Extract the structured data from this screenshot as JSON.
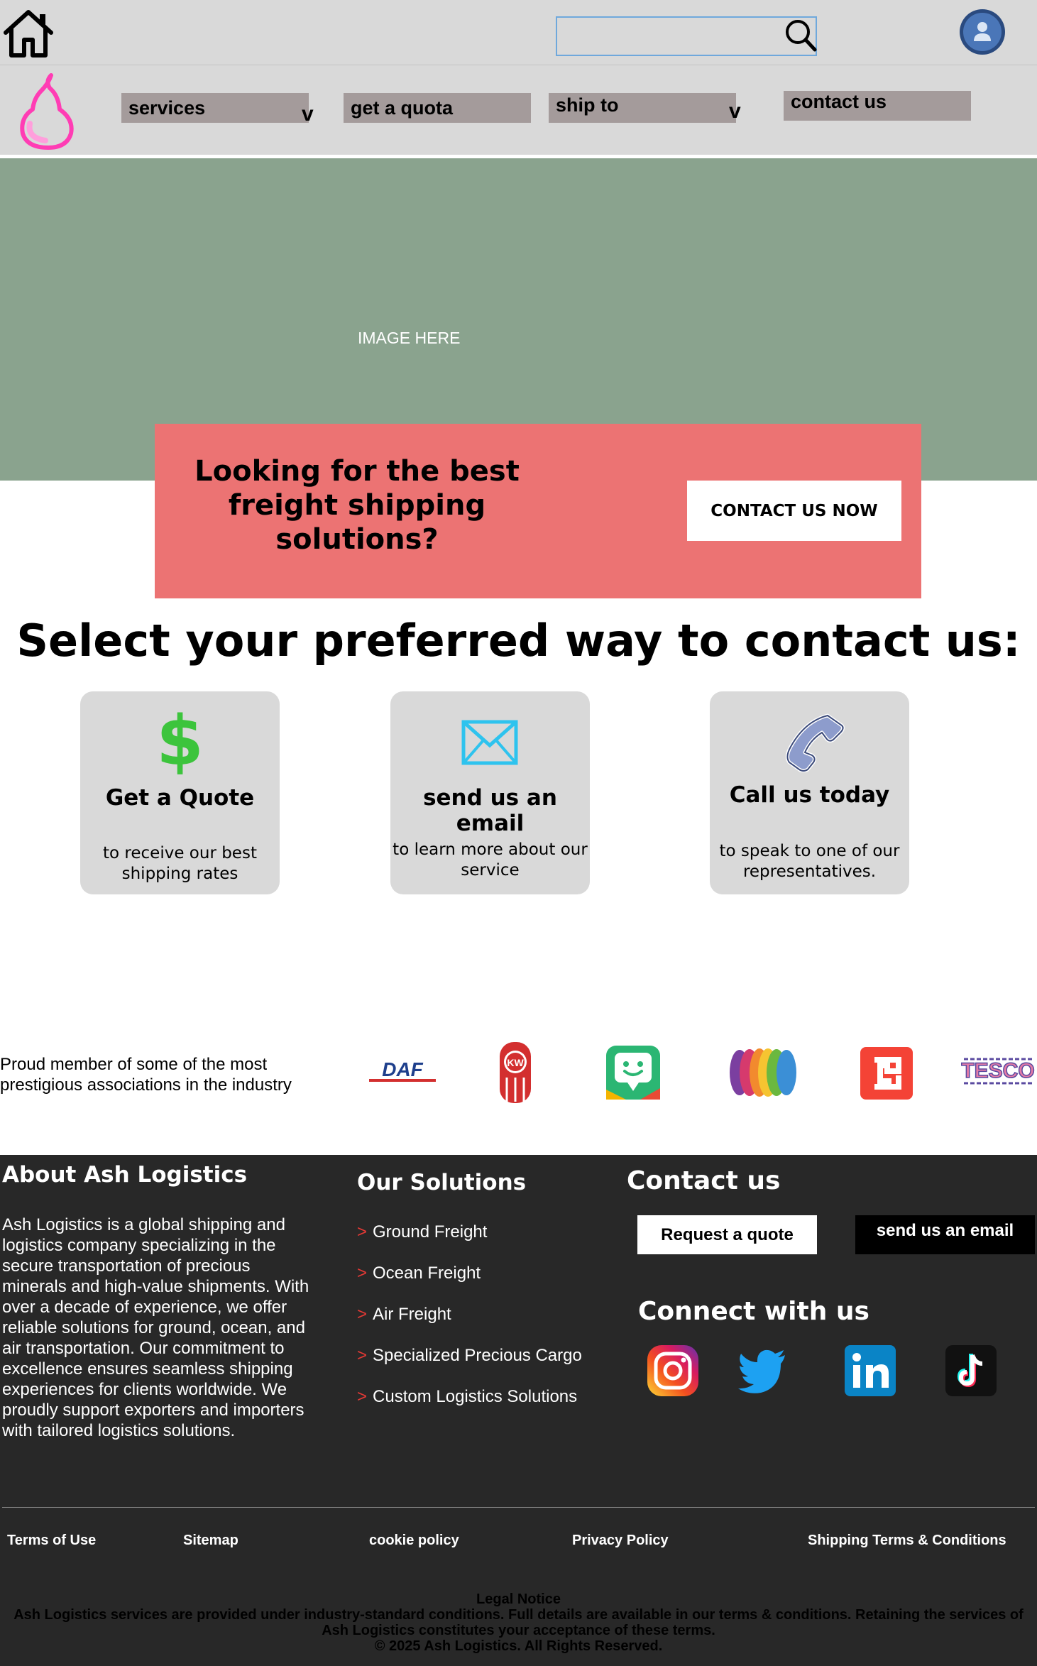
{
  "header": {
    "search_placeholder": ""
  },
  "nav": {
    "items": [
      {
        "label": "services",
        "chevron": "v"
      },
      {
        "label": "get a quota"
      },
      {
        "label": "ship to",
        "chevron": "v"
      },
      {
        "label": "contact us"
      }
    ]
  },
  "hero": {
    "placeholder_text": "IMAGE HERE"
  },
  "promo": {
    "title": "Looking for the best freight shipping solutions?",
    "button": "CONTACT US NOW"
  },
  "contact_options": {
    "title": "Select your preferred way to contact us:",
    "cards": [
      {
        "icon": "dollar-icon",
        "title": "Get a Quote",
        "description": "to receive our best shipping rates"
      },
      {
        "icon": "envelope-icon",
        "title": "send us an email",
        "description": "to learn more about our service"
      },
      {
        "icon": "phone-icon",
        "title": "Call us today",
        "description": "to speak to one of our representatives."
      }
    ]
  },
  "members": {
    "text": "Proud member of some of the most prestigious associations in the industry",
    "logos": [
      {
        "name": "daf-logo",
        "label": "DAF",
        "color": "#1e3f8c"
      },
      {
        "name": "kenworth-logo",
        "label": "KW",
        "color": "#d32f2f"
      },
      {
        "name": "chat-app-logo",
        "color": "#2bb673"
      },
      {
        "name": "colorful-petals-logo",
        "color": "#8e44ad"
      },
      {
        "name": "square-s-logo",
        "color": "#f44336"
      },
      {
        "name": "tesco-logo",
        "label": "TESCO",
        "color": "#e57ba6"
      }
    ]
  },
  "footer": {
    "about": {
      "heading": "About Ash Logistics",
      "body": "Ash Logistics is a global shipping and logistics company specializing in the secure transportation of precious minerals and high-value shipments. With over a decade of experience, we offer reliable solutions for ground, ocean, and air transportation. Our commitment to excellence ensures seamless shipping experiences for clients worldwide. We proudly support exporters and importers with tailored logistics solutions."
    },
    "solutions": {
      "heading": "Our Solutions",
      "items": [
        "Ground Freight",
        "Ocean Freight",
        "Air Freight",
        "Specialized Precious Cargo",
        "Custom Logistics Solutions"
      ],
      "bullet": ">"
    },
    "contact": {
      "heading": "Contact us",
      "quote_button": "Request a quote",
      "email_button": "send us an email",
      "connect_heading": "Connect with us",
      "socials": [
        "instagram-icon",
        "twitter-icon",
        "linkedin-icon",
        "tiktok-icon"
      ]
    },
    "links": [
      "Terms of Use",
      "Sitemap",
      "cookie policy",
      "Privacy Policy",
      "Shipping Terms & Conditions"
    ],
    "legal": {
      "title": "Legal Notice",
      "body": "Ash Logistics services are provided under industry-standard conditions. Full details are available in our terms & conditions. Retaining the services of Ash Logistics constitutes your acceptance of these terms.",
      "copyright": "© 2025 Ash Logistics. All Rights Reserved."
    }
  },
  "colors": {
    "bar_bg": "#d9d9d9",
    "nav_item_bg": "#a49b9b",
    "hero_bg": "#8aa38e",
    "promo_bg": "#ec7373",
    "footer_bg": "#282828",
    "logo_pink": "#ff3db4"
  }
}
